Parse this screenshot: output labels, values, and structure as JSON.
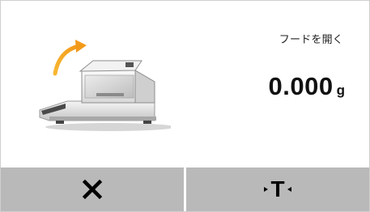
{
  "screen": {
    "instruction": "フードを開く",
    "weight": {
      "value": "0.000",
      "unit": "g"
    },
    "illustration_icon": "balance-hood-open-icon",
    "arrow_color": "#f5a623"
  },
  "softkeys": {
    "cancel": {
      "icon": "close-icon"
    },
    "tare": {
      "label": "T",
      "icon": "tare-icon"
    }
  },
  "colors": {
    "background": "#ffffff",
    "softkey_background": "#b9b9b9",
    "text": "#111111"
  }
}
